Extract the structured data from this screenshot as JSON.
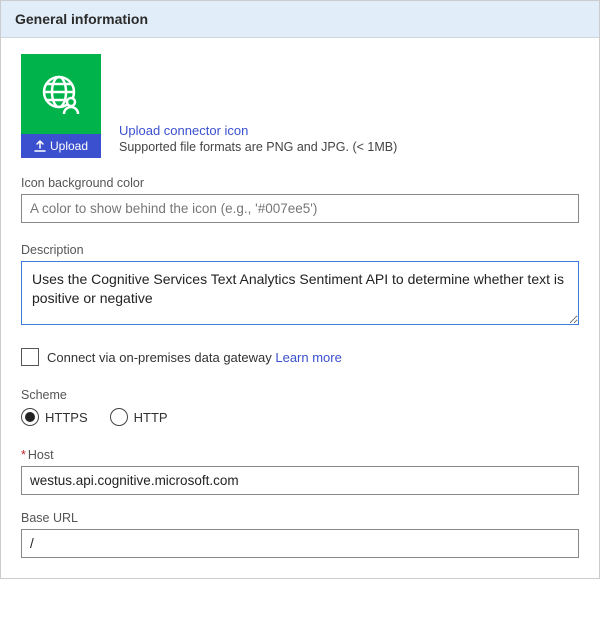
{
  "section_title": "General information",
  "icon": {
    "upload_button_label": "Upload",
    "link_label": "Upload connector icon",
    "hint": "Supported file formats are PNG and JPG. (< 1MB)",
    "bg_color": "#00B44B"
  },
  "icon_bg_color": {
    "label": "Icon background color",
    "placeholder": "A color to show behind the icon (e.g., '#007ee5')",
    "value": ""
  },
  "description": {
    "label": "Description",
    "value": "Uses the Cognitive Services Text Analytics Sentiment API to determine whether text is positive or negative"
  },
  "gateway": {
    "label": "Connect via on-premises data gateway",
    "learn_more": "Learn more",
    "checked": false
  },
  "scheme": {
    "label": "Scheme",
    "options": [
      "HTTPS",
      "HTTP"
    ],
    "selected": "HTTPS"
  },
  "host": {
    "label": "Host",
    "required_mark": "*",
    "value": "westus.api.cognitive.microsoft.com"
  },
  "base_url": {
    "label": "Base URL",
    "value": "/"
  }
}
